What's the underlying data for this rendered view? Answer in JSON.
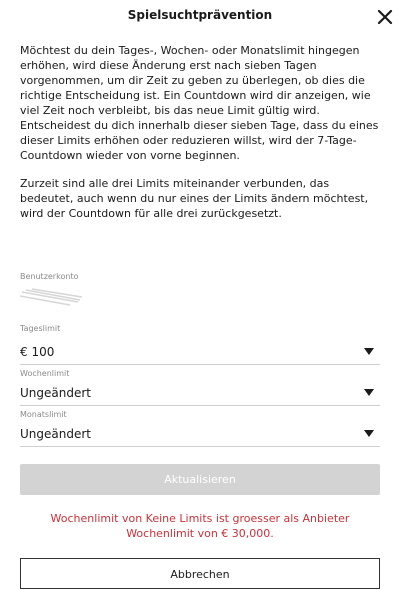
{
  "header": {
    "title": "Spielsuchtprävention",
    "close_icon": "close-icon"
  },
  "info": {
    "paragraph1": "Möchtest du dein Tages-, Wochen- oder Monatslimit hingegen erhöhen, wird diese Änderung erst nach sieben Tagen vorgenommen, um dir Zeit zu geben zu überlegen, ob dies die richtige Entscheidung ist. Ein Countdown wird dir anzeigen, wie viel Zeit noch verbleibt, bis das neue Limit gültig wird. Entscheidest du dich innerhalb dieser sieben Tage, dass du eines dieser Limits erhöhen oder reduzieren willst, wird der 7-Tage-Countdown wieder von vorne beginnen.",
    "paragraph2": "Zurzeit sind alle drei Limits miteinander verbunden, das bedeutet, auch wenn du nur eines der Limits ändern möchtest, wird der Countdown für alle drei zurückgesetzt."
  },
  "form": {
    "account_label": "Benutzerkonto",
    "daily_label": "Tageslimit",
    "daily_value": "€ 100",
    "weekly_label": "Wochenlimit",
    "weekly_value": "Ungeändert",
    "monthly_label": "Monatslimit",
    "monthly_value": "Ungeändert",
    "dropdown_icon": "caret-down-icon"
  },
  "actions": {
    "update_label": "Aktualisieren",
    "cancel_label": "Abbrechen"
  },
  "error": {
    "message": "Wochenlimit von Keine Limits ist groesser als Anbieter Wochenlimit von € 30,000."
  },
  "colors": {
    "error": "#c8323a",
    "disabled_button": "#d3d3d3",
    "label_gray": "#8a8a8a"
  }
}
